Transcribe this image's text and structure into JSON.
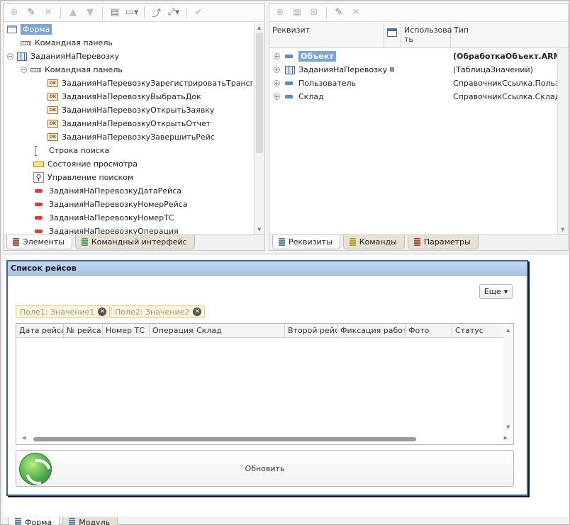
{
  "left_toolbar": {
    "icons": [
      "add-icon",
      "edit-icon",
      "delete-icon",
      "move-up-icon",
      "move-down-icon",
      "command-bar-icon",
      "layout-icon",
      "swap-icon",
      "resize-icon",
      "check-icon"
    ]
  },
  "left_tree": {
    "items": [
      {
        "label": "Форма",
        "icon": "form-icon",
        "selected": true
      },
      {
        "label": "Командная панель",
        "icon": "command-panel-icon"
      },
      {
        "label": "ЗаданияНаПеревозку",
        "icon": "table-icon"
      },
      {
        "label": "Командная панель",
        "icon": "command-panel-icon"
      },
      {
        "label": "ЗаданияНаПеревозкуЗарегистрироватьТранспор...",
        "icon": "button-icon"
      },
      {
        "label": "ЗаданияНаПеревозкуВыбратьДок",
        "icon": "button-icon"
      },
      {
        "label": "ЗаданияНаПеревозкуОткрытьЗаявку",
        "icon": "button-icon"
      },
      {
        "label": "ЗаданияНаПеревозкуОткрытьОтчет",
        "icon": "button-icon"
      },
      {
        "label": "ЗаданияНаПеревозкуЗавершитьРейс",
        "icon": "button-icon"
      },
      {
        "label": "Строка поиска",
        "icon": "search-string-icon"
      },
      {
        "label": "Состояние просмотра",
        "icon": "view-state-icon"
      },
      {
        "label": "Управление поиском",
        "icon": "search-control-icon"
      },
      {
        "label": "ЗаданияНаПеревозкуДатаРейса",
        "icon": "field-icon"
      },
      {
        "label": "ЗаданияНаПеревозкуНомерРейса",
        "icon": "field-icon"
      },
      {
        "label": "ЗаданияНаПеревозкуНомерТС",
        "icon": "field-icon"
      },
      {
        "label": "ЗаданияНаПеревозкуОперация",
        "icon": "field-icon"
      }
    ]
  },
  "left_tabs": {
    "elements": "Элементы",
    "command_interface": "Командный интерфейс"
  },
  "right_toolbar": {
    "icons": [
      "add-attribute-icon",
      "add-table-icon",
      "add-column-icon",
      "edit-icon",
      "delete-icon"
    ]
  },
  "right_grid": {
    "headers": {
      "attribute": "Реквизит",
      "use": "Использова ть",
      "type": "Тип"
    },
    "rows": [
      {
        "name": "Объект",
        "type": "(ОбработкаОбъект.ARM...",
        "bold": true,
        "selected": true
      },
      {
        "name": "ЗаданияНаПеревозку",
        "type": "(ТаблицаЗначений)"
      },
      {
        "name": "Пользователь",
        "type": "СправочникСсылка.Пользов..."
      },
      {
        "name": "Склад",
        "type": "СправочникСсылка.Склады"
      }
    ]
  },
  "right_tabs": {
    "attributes": "Реквизиты",
    "commands": "Команды",
    "parameters": "Параметры"
  },
  "preview": {
    "title": "Список рейсов",
    "more_button": "Еще",
    "filters": [
      {
        "label": "Поле1: Значение1"
      },
      {
        "label": "Поле2: Значение2"
      }
    ],
    "columns": [
      "Дата рейса",
      "№ рейса",
      "Номер ТС",
      "Операция",
      "Склад",
      "Второй рейс",
      "Фиксация работ",
      "Фото",
      "Статус"
    ],
    "refresh_label": "Обновить"
  },
  "bottom_tabs": {
    "form": "Форма",
    "module": "Модуль"
  },
  "colors": {
    "accent": "#2f64b0",
    "selection": "#7ba4d8",
    "title_bar": "#a9c3e6"
  }
}
